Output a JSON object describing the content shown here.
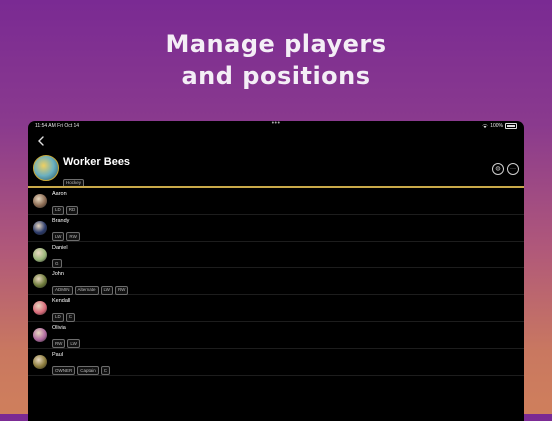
{
  "headline": {
    "line1": "Manage players",
    "line2": "and positions"
  },
  "statusbar": {
    "time": "11:54 AM  Fri Oct 14",
    "dots": "•••",
    "battery": "100%"
  },
  "team": {
    "name": "Worker Bees",
    "sport": "Hockey"
  },
  "header": {
    "chat_icon": "chat-icon",
    "more_icon": "more-icon",
    "chat_glyph": "◍",
    "more_glyph": "···"
  },
  "colors": {
    "accent": "#c9a94a",
    "background": "#000000"
  },
  "players": [
    {
      "name": "Aaron",
      "tags": [
        "LD",
        "RD"
      ],
      "avatar": "#8a6a52"
    },
    {
      "name": "Brandy",
      "tags": [
        "LW",
        "RW"
      ],
      "avatar": "#2a3a6a"
    },
    {
      "name": "Daniel",
      "tags": [
        "G"
      ],
      "avatar": "#9ab67a"
    },
    {
      "name": "John",
      "tags": [
        "ADMIN",
        "Alternate",
        "LW",
        "RW"
      ],
      "avatar": "#6d7a3a"
    },
    {
      "name": "Kendall",
      "tags": [
        "LD",
        "C"
      ],
      "avatar": "#d86a7a"
    },
    {
      "name": "Olivia",
      "tags": [
        "RW",
        "LW"
      ],
      "avatar": "#b06aa0"
    },
    {
      "name": "Paul",
      "tags": [
        "OWNER",
        "Captain",
        "C"
      ],
      "avatar": "#8a7a3a"
    }
  ]
}
